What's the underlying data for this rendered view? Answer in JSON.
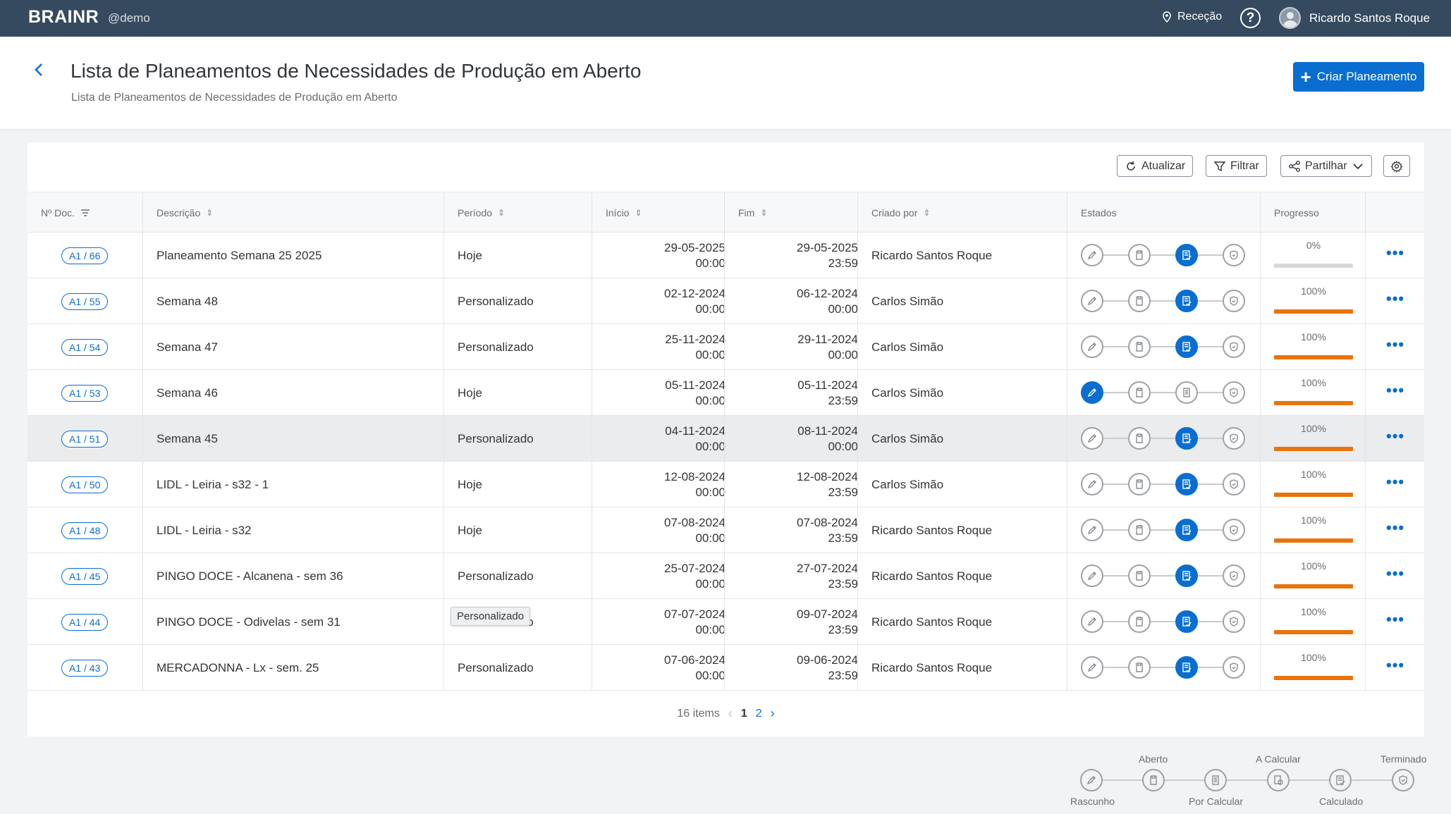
{
  "topbar": {
    "brand": "BRAINR",
    "brand_sub": "@demo",
    "location": "Receção",
    "help": "?",
    "user_name": "Ricardo Santos Roque"
  },
  "header": {
    "title": "Lista de Planeamentos de Necessidades de Produção em Aberto",
    "subtitle": "Lista de Planeamentos de Necessidades de Produção em Aberto",
    "create_label": "Criar Planeamento"
  },
  "toolbar": {
    "refresh_label": "Atualizar",
    "filter_label": "Filtrar",
    "share_label": "Partilhar"
  },
  "columns": {
    "doc": "Nº Doc.",
    "description": "Descrição",
    "period": "Período",
    "start": "Início",
    "end": "Fim",
    "created_by": "Criado por",
    "states": "Estados",
    "progress": "Progresso"
  },
  "rows": [
    {
      "doc": "A1 / 66",
      "description": "Planeamento Semana 25 2025",
      "period": "Hoje",
      "start_date": "29-05-2025",
      "start_time": "00:00",
      "end_date": "29-05-2025",
      "end_time": "23:59",
      "created_by": "Ricardo Santos Roque",
      "active_state": 2,
      "progress_label": "0%",
      "progress": 0
    },
    {
      "doc": "A1 / 55",
      "description": "Semana 48",
      "period": "Personalizado",
      "start_date": "02-12-2024",
      "start_time": "00:00",
      "end_date": "06-12-2024",
      "end_time": "00:00",
      "created_by": "Carlos Simão",
      "active_state": 2,
      "progress_label": "100%",
      "progress": 100
    },
    {
      "doc": "A1 / 54",
      "description": "Semana 47",
      "period": "Personalizado",
      "start_date": "25-11-2024",
      "start_time": "00:00",
      "end_date": "29-11-2024",
      "end_time": "00:00",
      "created_by": "Carlos Simão",
      "active_state": 2,
      "progress_label": "100%",
      "progress": 100
    },
    {
      "doc": "A1 / 53",
      "description": "Semana 46",
      "period": "Hoje",
      "start_date": "05-11-2024",
      "start_time": "00:00",
      "end_date": "05-11-2024",
      "end_time": "23:59",
      "created_by": "Carlos Simão",
      "active_state": 0,
      "progress_label": "100%",
      "progress": 100
    },
    {
      "doc": "A1 / 51",
      "description": "Semana 45",
      "period": "Personalizado",
      "start_date": "04-11-2024",
      "start_time": "00:00",
      "end_date": "08-11-2024",
      "end_time": "00:00",
      "created_by": "Carlos Simão",
      "active_state": 2,
      "progress_label": "100%",
      "progress": 100
    },
    {
      "doc": "A1 / 50",
      "description": "LIDL - Leiria - s32 - 1",
      "period": "Hoje",
      "start_date": "12-08-2024",
      "start_time": "00:00",
      "end_date": "12-08-2024",
      "end_time": "23:59",
      "created_by": "Carlos Simão",
      "active_state": 2,
      "progress_label": "100%",
      "progress": 100
    },
    {
      "doc": "A1 / 48",
      "description": "LIDL - Leiria - s32",
      "period": "Hoje",
      "start_date": "07-08-2024",
      "start_time": "00:00",
      "end_date": "07-08-2024",
      "end_time": "23:59",
      "created_by": "Ricardo Santos Roque",
      "active_state": 2,
      "progress_label": "100%",
      "progress": 100
    },
    {
      "doc": "A1 / 45",
      "description": "PINGO DOCE - Alcanena - sem 36",
      "period": "Personalizado",
      "start_date": "25-07-2024",
      "start_time": "00:00",
      "end_date": "27-07-2024",
      "end_time": "23:59",
      "created_by": "Ricardo Santos Roque",
      "active_state": 2,
      "progress_label": "100%",
      "progress": 100
    },
    {
      "doc": "A1 / 44",
      "description": "PINGO DOCE - Odivelas - sem 31",
      "period": "Personalizado",
      "start_date": "07-07-2024",
      "start_time": "00:00",
      "end_date": "09-07-2024",
      "end_time": "23:59",
      "created_by": "Ricardo Santos Roque",
      "active_state": 2,
      "progress_label": "100%",
      "progress": 100
    },
    {
      "doc": "A1 / 43",
      "description": "MERCADONNA - Lx - sem. 25",
      "period": "Personalizado",
      "start_date": "07-06-2024",
      "start_time": "00:00",
      "end_date": "09-06-2024",
      "end_time": "23:59",
      "created_by": "Ricardo Santos Roque",
      "active_state": 2,
      "progress_label": "100%",
      "progress": 100
    }
  ],
  "tooltip": "Personalizado",
  "pager": {
    "items_label": "16 items",
    "page1": "1",
    "page2": "2"
  },
  "legend": {
    "rascunho": "Rascunho",
    "aberto": "Aberto",
    "por_calcular": "Por Calcular",
    "a_calcular": "A Calcular",
    "calculado": "Calculado",
    "terminado": "Terminado"
  },
  "colors": {
    "topbar": "#354a5f",
    "accent": "#0a6ed1",
    "progress": "#e9730c"
  },
  "icons": {
    "state_1": "pencil-icon",
    "state_2": "document-icon",
    "state_3": "calculated-doc-icon",
    "state_4": "shield-check-icon"
  }
}
